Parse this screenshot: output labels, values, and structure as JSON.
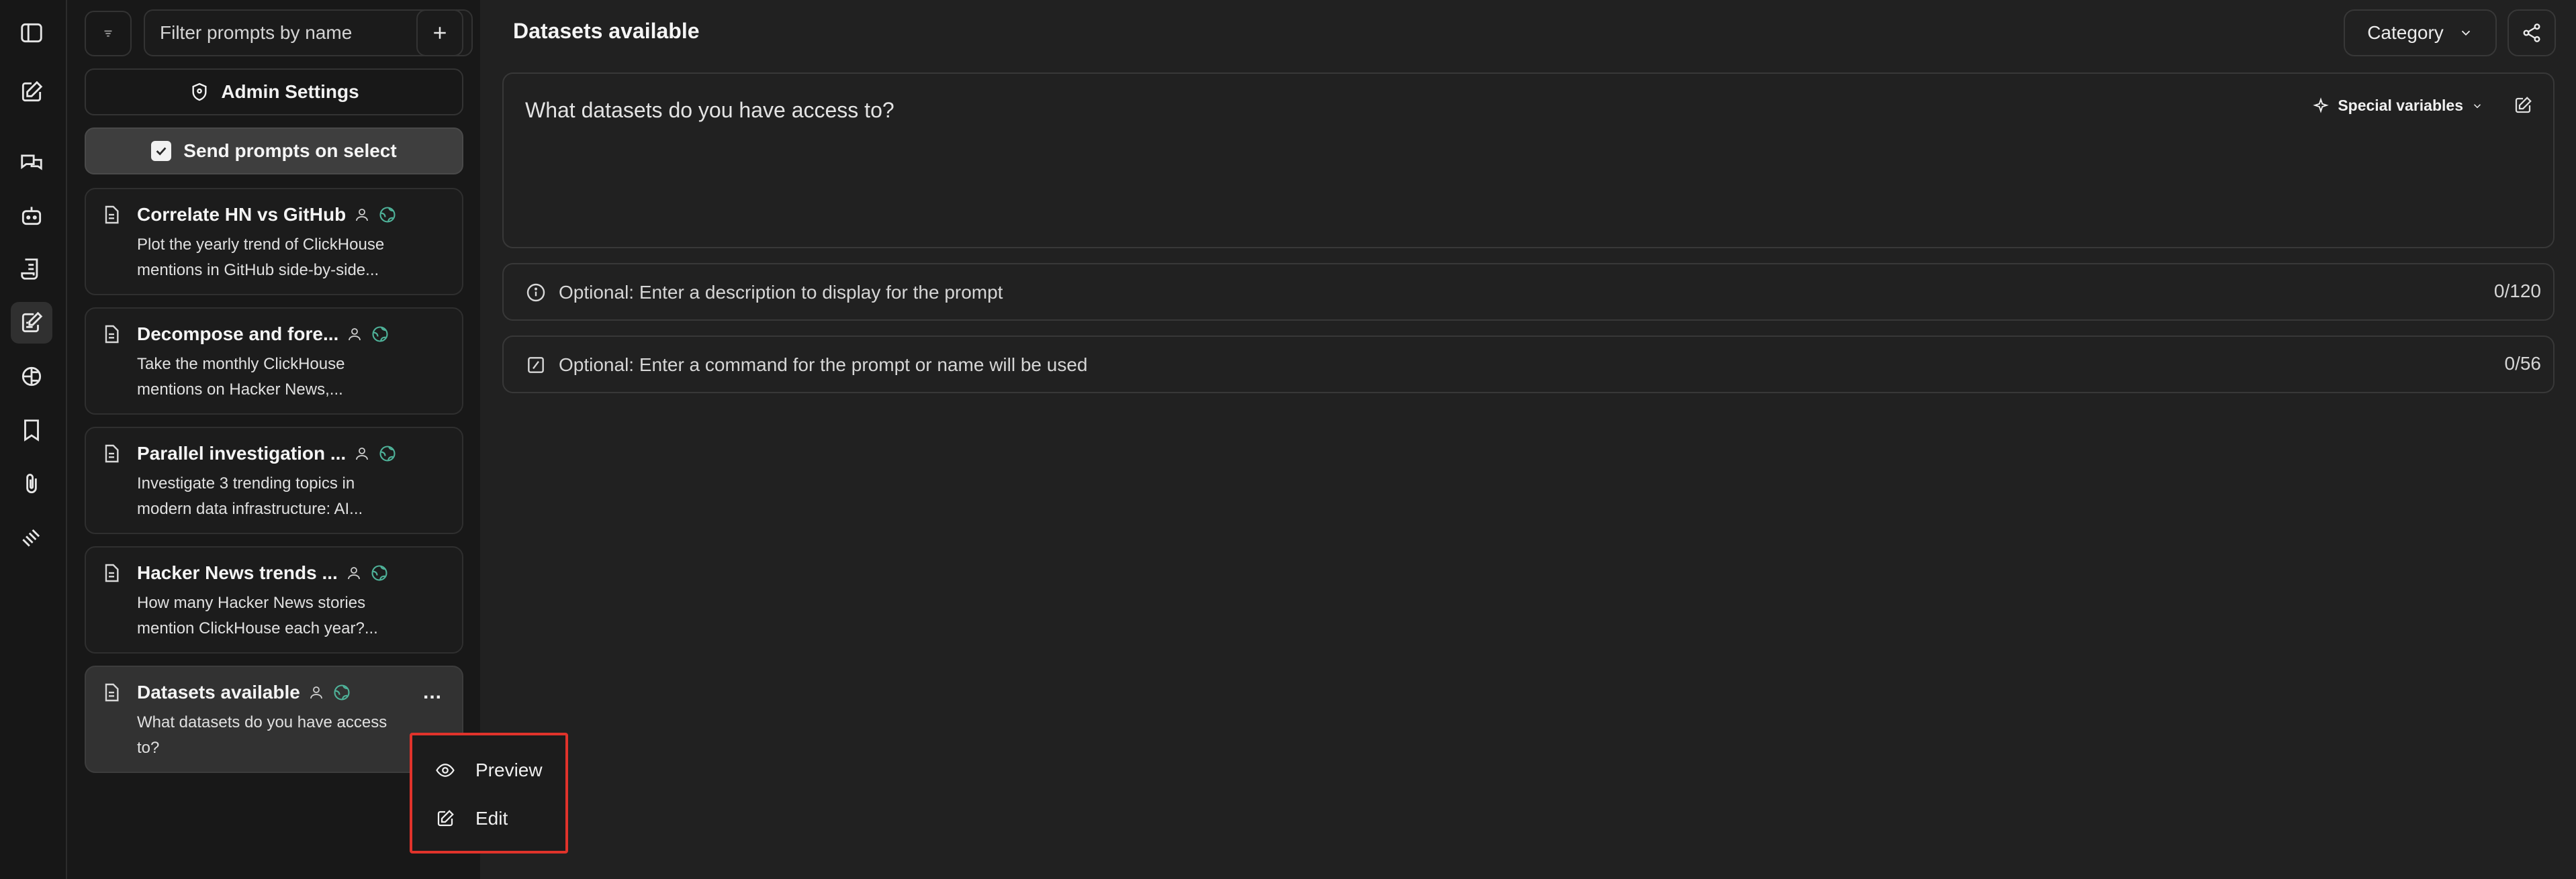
{
  "rail": {
    "icons": [
      "sidebar-toggle-icon",
      "new-chat-icon",
      "chats-icon",
      "bots-icon",
      "notes-icon",
      "prompts-icon",
      "brain-icon",
      "bookmark-icon",
      "attachment-icon",
      "plugin-icon"
    ]
  },
  "prompt_list": {
    "filter_placeholder": "Filter prompts by name",
    "admin_settings_label": "Admin Settings",
    "send_on_select_label": "Send prompts on select",
    "send_on_select_checked": true,
    "cards": [
      {
        "title": "Correlate HN vs GitHub",
        "description": "Plot the yearly trend of ClickHouse mentions in GitHub side-by-side..."
      },
      {
        "title": "Decompose and fore...",
        "description": "Take the monthly ClickHouse mentions on Hacker News,..."
      },
      {
        "title": "Parallel investigation ...",
        "description": "Investigate 3 trending topics in modern data infrastructure: AI..."
      },
      {
        "title": "Hacker News trends ...",
        "description": "How many Hacker News stories mention ClickHouse each year?..."
      },
      {
        "title": "Datasets available",
        "description": "What datasets do you have access to?",
        "selected": true,
        "more_label": "..."
      }
    ]
  },
  "context_menu": {
    "items": [
      {
        "label": "Preview",
        "icon": "eye-icon"
      },
      {
        "label": "Edit",
        "icon": "edit-icon"
      }
    ],
    "highlight_color": "#e0332b"
  },
  "main": {
    "title": "Datasets available",
    "category_label": "Category",
    "prompt_content": "What datasets do you have access to?",
    "special_variables_label": "Special variables",
    "description_placeholder": "Optional: Enter a description to display for the prompt",
    "description_count": "0/120",
    "command_placeholder": "Optional: Enter a command for the prompt or name will be used",
    "command_count": "0/56"
  },
  "colors": {
    "background": "#212121",
    "sidebar": "#171717",
    "accent_globe": "#4fb39a"
  }
}
